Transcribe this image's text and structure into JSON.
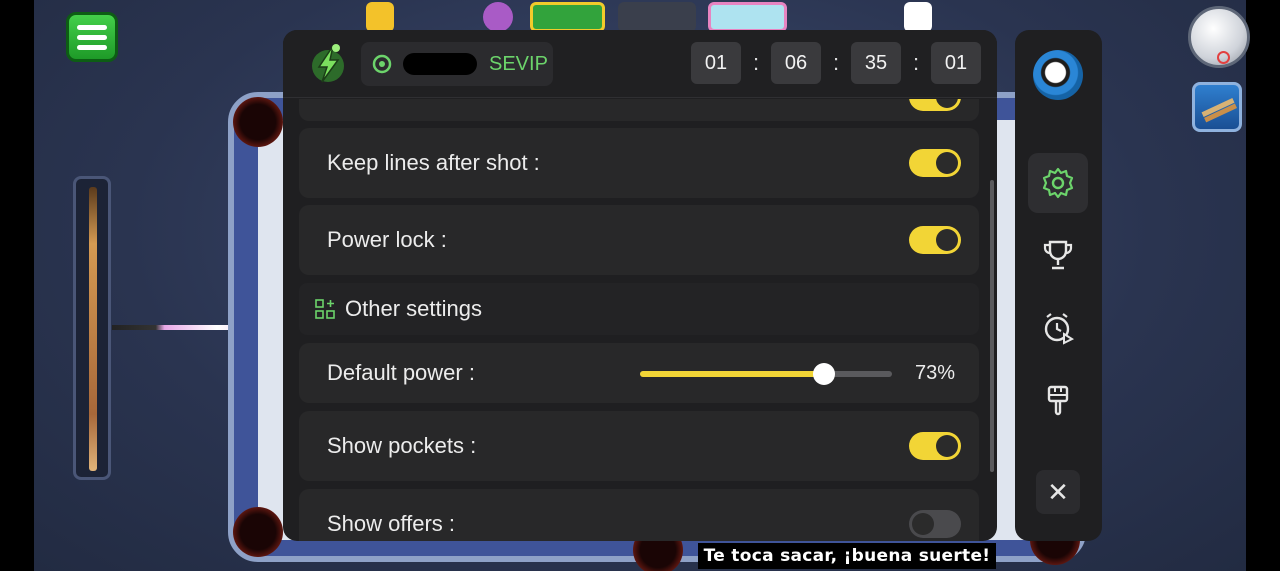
{
  "header": {
    "brand": "SEVIP",
    "timer": [
      "01",
      "06",
      "35",
      "01"
    ]
  },
  "settings": {
    "keep_lines_label": "Keep lines after shot :",
    "keep_lines_on": true,
    "power_lock_label": "Power lock :",
    "power_lock_on": true,
    "section_title": "Other settings",
    "default_power_label": "Default power :",
    "default_power_value": "73%",
    "default_power_fraction": 0.73,
    "show_pockets_label": "Show pockets :",
    "show_pockets_on": true,
    "show_offers_label": "Show offers :",
    "show_offers_on": false
  },
  "side_rail": {
    "items": [
      "pool-profile-icon",
      "gear-icon",
      "trophy-icon",
      "timer-icon",
      "brush-icon"
    ],
    "close_label": "✕"
  },
  "game": {
    "turn_message": "Te toca sacar, ¡buena suerte!"
  },
  "colors": {
    "accent_yellow": "#f2d536",
    "vip_green": "#6cd46b",
    "panel_bg": "#1f1f21"
  }
}
